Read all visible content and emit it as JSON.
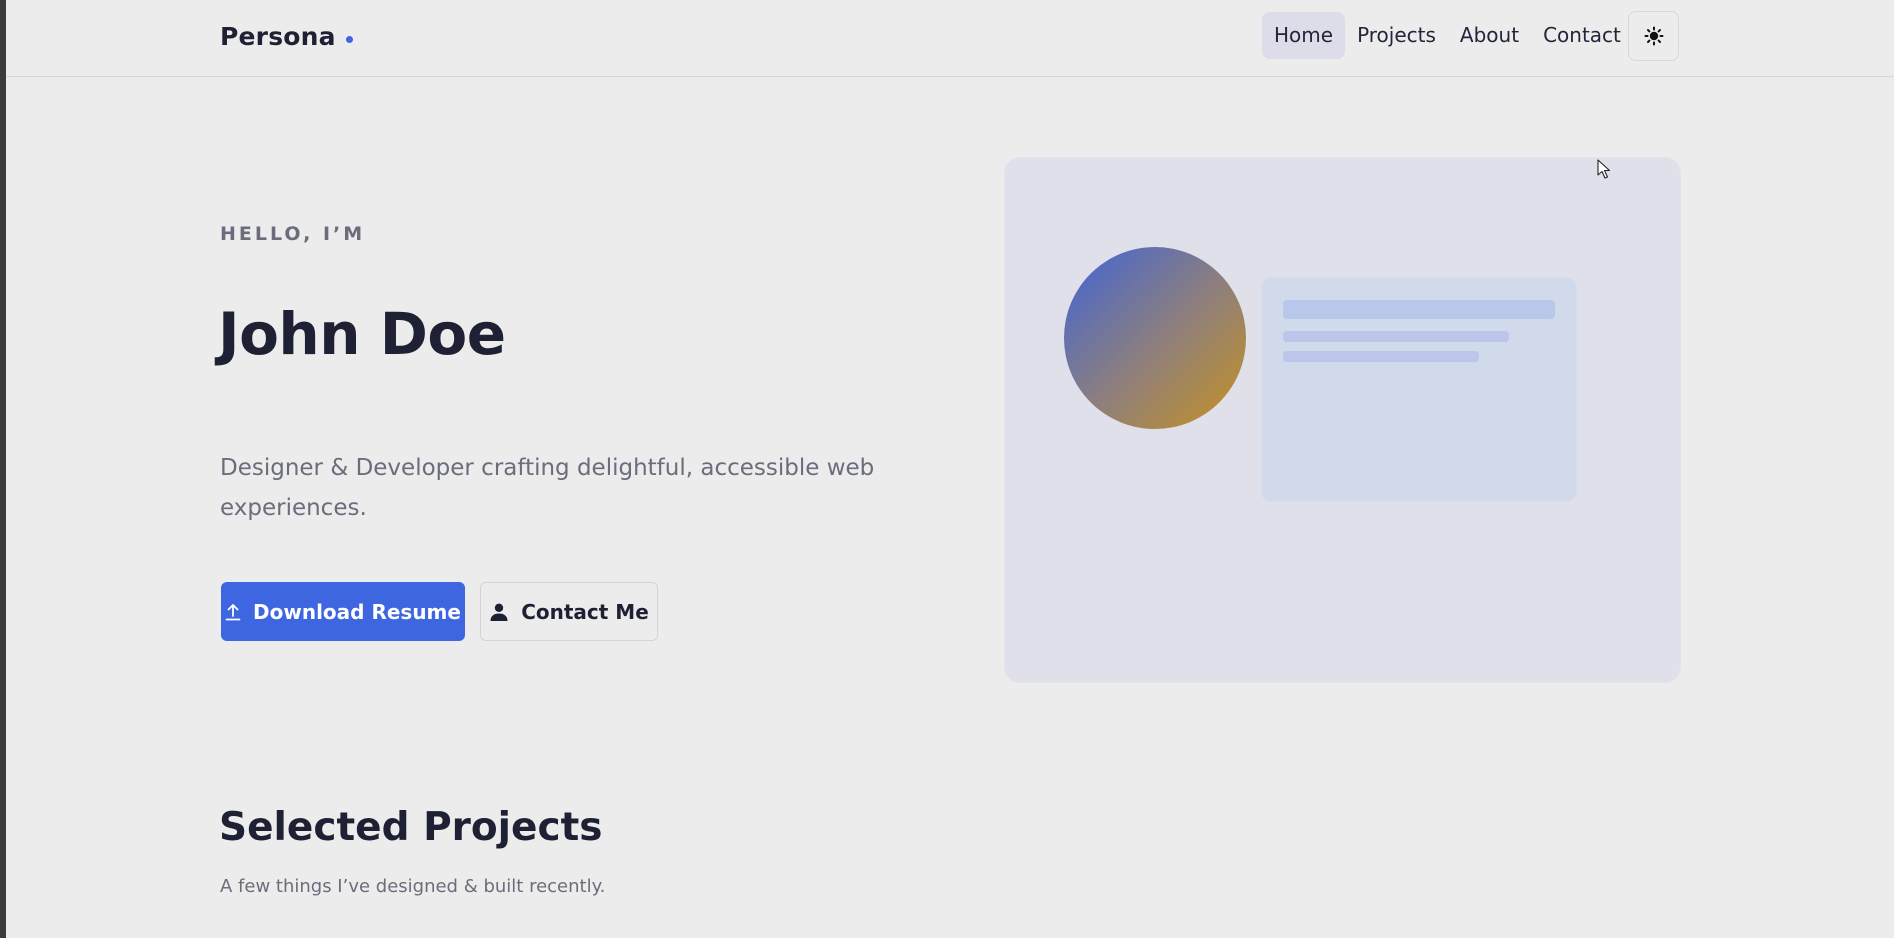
{
  "header": {
    "logo": "Persona",
    "nav": [
      {
        "label": "Home",
        "active": true
      },
      {
        "label": "Projects",
        "active": false
      },
      {
        "label": "About",
        "active": false
      },
      {
        "label": "Contact",
        "active": false
      }
    ],
    "theme_toggle_icon": "sun-icon"
  },
  "hero": {
    "eyebrow": "HELLO, I’M",
    "name": "John Doe",
    "description": "Designer & Developer crafting delightful, accessible web experiences.",
    "primary_button": {
      "label": "Download Resume",
      "icon": "upload-icon"
    },
    "secondary_button": {
      "label": "Contact Me",
      "icon": "user-icon"
    }
  },
  "projects": {
    "title": "Selected Projects",
    "subtitle": "A few things I’ve designed & built recently."
  },
  "colors": {
    "accent": "#3d66e0",
    "background": "#ececec",
    "text": "#1e2033",
    "muted": "#6b6d7c"
  }
}
